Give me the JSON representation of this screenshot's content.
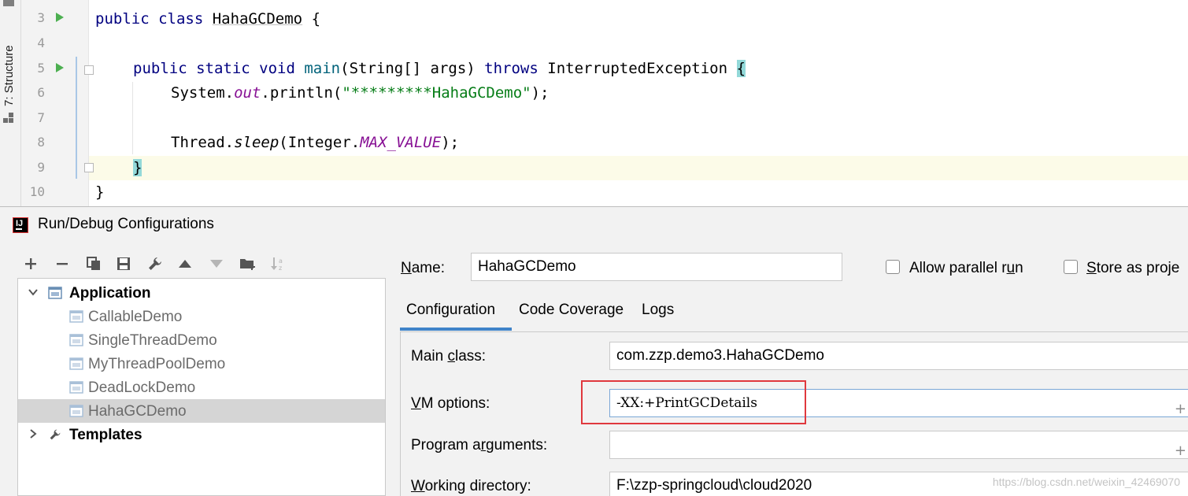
{
  "editor": {
    "tool_window_label": "7: Structure",
    "line_numbers": [
      "3",
      "4",
      "5",
      "6",
      "7",
      "8",
      "9",
      "10"
    ],
    "code": {
      "class_kw": "public class",
      "class_name": "HahaGCDemo",
      "class_open": " {",
      "method_mods": "public static void",
      "method_name": "main",
      "method_params": "(String[] args)",
      "throws_kw": "throws",
      "exception": "InterruptedException",
      "method_open": "{",
      "print_prefix": "System.",
      "print_out": "out",
      "print_call": ".println(",
      "print_str": "\"*********HahaGCDemo\"",
      "print_end": ");",
      "sleep_prefix": "Thread.",
      "sleep_name": "sleep",
      "sleep_open": "(Integer.",
      "max_value": "MAX_VALUE",
      "sleep_end": ");",
      "method_close": "}",
      "class_close": "}"
    }
  },
  "dialog": {
    "title": "Run/Debug Configurations",
    "app_icon_text": "IJ",
    "toolbar": [
      {
        "name": "add-icon",
        "enabled": true
      },
      {
        "name": "remove-icon",
        "enabled": true
      },
      {
        "name": "copy-icon",
        "enabled": true
      },
      {
        "name": "save-icon",
        "enabled": true
      },
      {
        "name": "wrench-icon",
        "enabled": true
      },
      {
        "name": "move-up-icon",
        "enabled": true
      },
      {
        "name": "move-down-icon",
        "enabled": false
      },
      {
        "name": "folder-add-icon",
        "enabled": true
      },
      {
        "name": "sort-icon",
        "enabled": false
      }
    ],
    "tree": {
      "group": "Application",
      "children": [
        "CallableDemo",
        "SingleThreadDemo",
        "MyThreadPoolDemo",
        "DeadLockDemo",
        "HahaGCDemo"
      ],
      "selected_child": "HahaGCDemo",
      "templates": "Templates"
    },
    "name_field": {
      "label_mnemonic": "N",
      "label_rest": "ame:",
      "value": "HahaGCDemo"
    },
    "allow_parallel": {
      "label_start": "Allow parallel r",
      "label_mnemonic": "u",
      "label_end": "n",
      "checked": false
    },
    "store_as_project": {
      "label_mnemonic": "S",
      "label_rest": "tore as proje",
      "checked": false
    },
    "tabs": [
      "Configuration",
      "Code Coverage",
      "Logs"
    ],
    "active_tab": "Configuration",
    "main_class": {
      "label_start": "Main ",
      "label_mnemonic": "c",
      "label_end": "lass:",
      "value": "com.zzp.demo3.HahaGCDemo"
    },
    "vm_options": {
      "label_mnemonic": "V",
      "label_rest": "M options:",
      "value": "-XX:+PrintGCDetails"
    },
    "program_args": {
      "label_start": "Program a",
      "label_mnemonic": "r",
      "label_end": "guments:",
      "value": ""
    },
    "working_dir": {
      "label_mnemonic": "W",
      "label_rest": "orking directory:",
      "value": "F:\\zzp-springcloud\\cloud2020"
    },
    "expand_glyph": "+",
    "highlight_color": "#e0383e"
  },
  "watermark": "https://blog.csdn.net/weixin_42469070"
}
